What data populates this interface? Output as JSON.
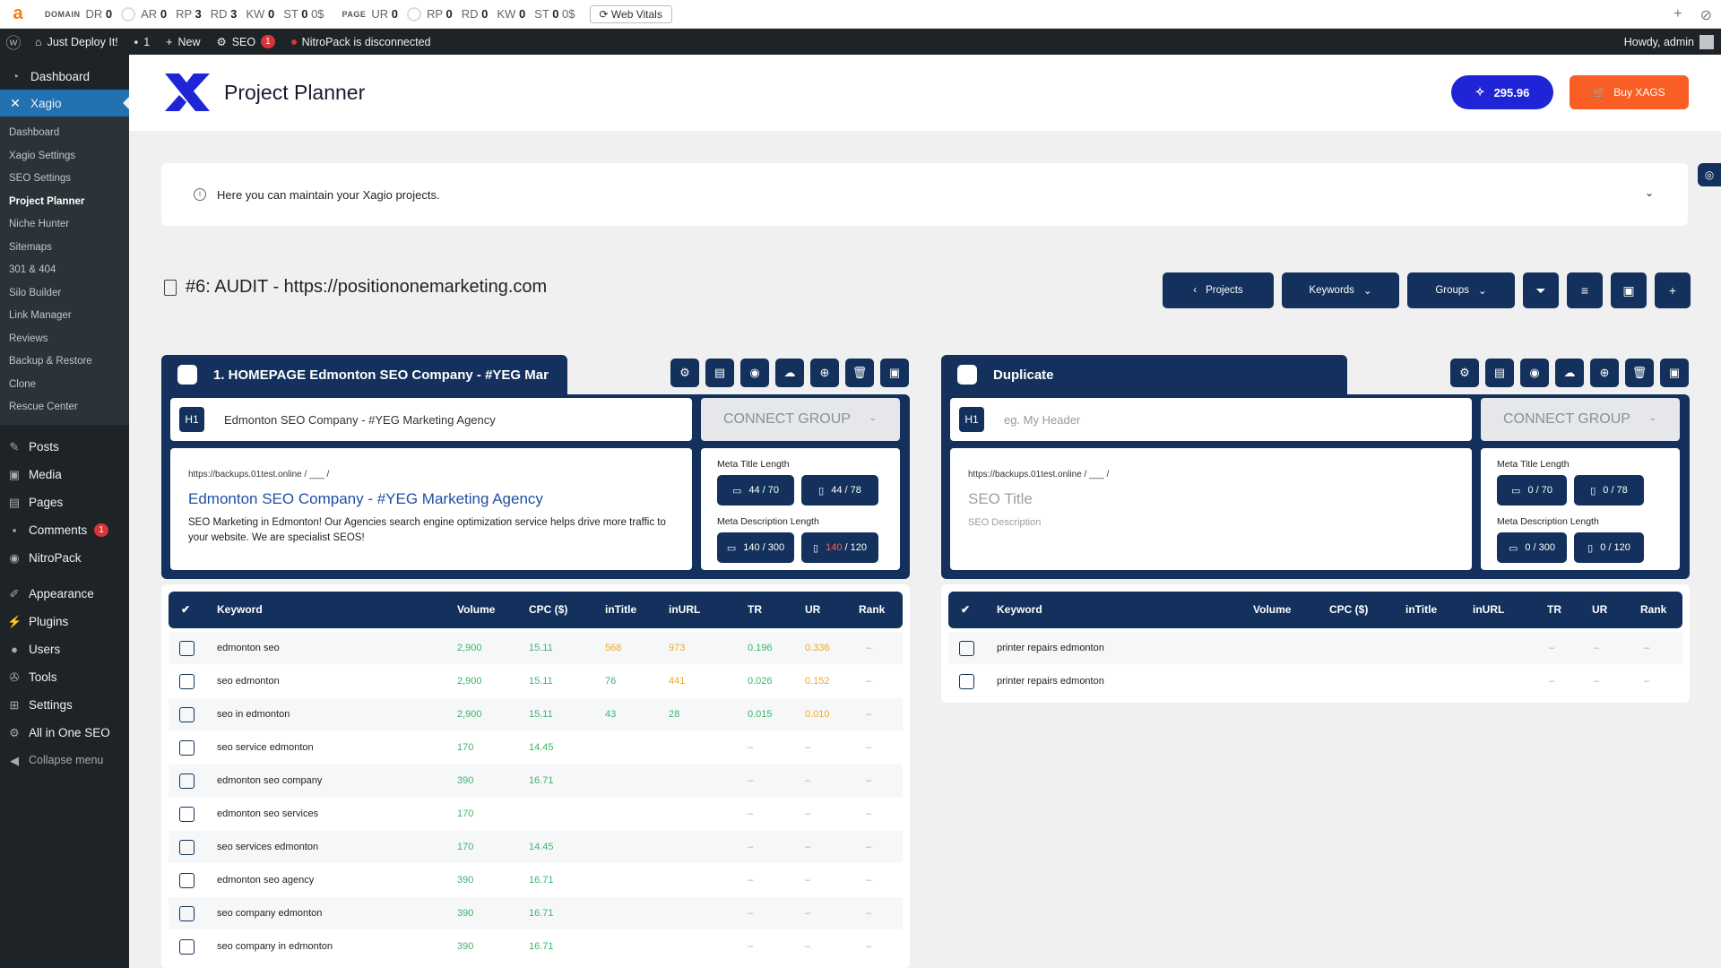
{
  "seobar": {
    "domain_label": "DOMAIN",
    "dr": "DR",
    "dr_v": "0",
    "ar": "AR",
    "ar_v": "0",
    "rp": "RP",
    "rp_v": "3",
    "rd": "RD",
    "rd_v": "3",
    "kw": "KW",
    "kw_v": "0",
    "st": "ST",
    "st_v": "0",
    "st_unit": "0$",
    "page_label": "PAGE",
    "ur": "UR",
    "ur_v": "0",
    "rp2_v": "0",
    "rd2_v": "0",
    "kw2_v": "0",
    "st2_v": "0",
    "st2_unit": "0$",
    "web_vitals": "Web Vitals"
  },
  "adminbar": {
    "site": "Just Deploy It!",
    "comments": "1",
    "new": "New",
    "seo": "SEO",
    "seo_badge": "1",
    "nitro": "NitroPack is disconnected",
    "howdy": "Howdy, admin"
  },
  "sidebar": {
    "dashboard": "Dashboard",
    "xagio": "Xagio",
    "sub": [
      "Dashboard",
      "Xagio Settings",
      "SEO Settings",
      "Project Planner",
      "Niche Hunter",
      "Sitemaps",
      "301 & 404",
      "Silo Builder",
      "Link Manager",
      "Reviews",
      "Backup & Restore",
      "Clone",
      "Rescue Center"
    ],
    "menu": [
      {
        "label": "Posts",
        "icon": "pin-icon"
      },
      {
        "label": "Media",
        "icon": "media-icon"
      },
      {
        "label": "Pages",
        "icon": "pages-icon"
      },
      {
        "label": "Comments",
        "icon": "comment-icon",
        "badge": "1"
      },
      {
        "label": "NitroPack",
        "icon": "nitro-icon"
      }
    ],
    "menu2": [
      {
        "label": "Appearance",
        "icon": "brush-icon"
      },
      {
        "label": "Plugins",
        "icon": "plug-icon"
      },
      {
        "label": "Users",
        "icon": "user-icon"
      },
      {
        "label": "Tools",
        "icon": "wrench-icon"
      },
      {
        "label": "Settings",
        "icon": "settings-icon"
      },
      {
        "label": "All in One SEO",
        "icon": "seo-icon"
      }
    ],
    "collapse": "Collapse menu"
  },
  "header": {
    "title": "Project Planner",
    "xags": "295.96",
    "buy": "Buy XAGS"
  },
  "notice": "Here you can maintain your Xagio projects.",
  "project_title": "#6: AUDIT - https://positiononemarketing.com",
  "tools": {
    "projects": "Projects",
    "keywords": "Keywords",
    "groups": "Groups"
  },
  "columns": {
    "keyword": "Keyword",
    "volume": "Volume",
    "cpc": "CPC ($)",
    "intitle": "inTitle",
    "inurl": "inURL",
    "tr": "TR",
    "ur": "UR",
    "rank": "Rank"
  },
  "group1": {
    "name": "1. HOMEPAGE Edmonton SEO Company - #YEG Mar",
    "h1": "Edmonton SEO Company - #YEG Marketing Agency",
    "connect": "CONNECT GROUP",
    "url": "https://backups.01test.online / ___ /",
    "seo_title": "Edmonton SEO Company - #YEG Marketing Agency",
    "seo_desc": "SEO Marketing in Edmonton! Our Agencies search engine optimization service helps drive more traffic to your website. We are specialist SEOS!",
    "meta_title_label": "Meta Title Length",
    "mt_desktop": "44 / 70",
    "mt_mobile": "44 / 78",
    "meta_desc_label": "Meta Description Length",
    "md_desktop": "140 / 300",
    "md_mobile_a": "140",
    "md_mobile_b": " / 120",
    "rows": [
      {
        "kw": "edmonton seo",
        "vol": "2,900",
        "cpc": "15.11",
        "intitle": "568",
        "inurl": "973",
        "tr": "0.196",
        "ur": "0.336",
        "rank": "–"
      },
      {
        "kw": "seo edmonton",
        "vol": "2,900",
        "cpc": "15.11",
        "intitle": "76",
        "inurl": "441",
        "tr": "0.026",
        "ur": "0.152",
        "rank": "–"
      },
      {
        "kw": "seo in edmonton",
        "vol": "2,900",
        "cpc": "15.11",
        "intitle": "43",
        "inurl": "28",
        "tr": "0.015",
        "ur": "0.010",
        "rank": "–"
      },
      {
        "kw": "seo service edmonton",
        "vol": "170",
        "cpc": "14.45",
        "intitle": "",
        "inurl": "",
        "tr": "–",
        "ur": "–",
        "rank": "–"
      },
      {
        "kw": "edmonton seo company",
        "vol": "390",
        "cpc": "16.71",
        "intitle": "",
        "inurl": "",
        "tr": "–",
        "ur": "–",
        "rank": "–"
      },
      {
        "kw": "edmonton seo services",
        "vol": "170",
        "cpc": "",
        "intitle": "",
        "inurl": "",
        "tr": "–",
        "ur": "–",
        "rank": "–"
      },
      {
        "kw": "seo services edmonton",
        "vol": "170",
        "cpc": "14.45",
        "intitle": "",
        "inurl": "",
        "tr": "–",
        "ur": "–",
        "rank": "–"
      },
      {
        "kw": "edmonton seo agency",
        "vol": "390",
        "cpc": "16.71",
        "intitle": "",
        "inurl": "",
        "tr": "–",
        "ur": "–",
        "rank": "–"
      },
      {
        "kw": "seo company edmonton",
        "vol": "390",
        "cpc": "16.71",
        "intitle": "",
        "inurl": "",
        "tr": "–",
        "ur": "–",
        "rank": "–"
      },
      {
        "kw": "seo company in edmonton",
        "vol": "390",
        "cpc": "16.71",
        "intitle": "",
        "inurl": "",
        "tr": "–",
        "ur": "–",
        "rank": "–"
      }
    ]
  },
  "group2": {
    "name": "Duplicate",
    "h1_placeholder": "eg. My Header",
    "connect": "CONNECT GROUP",
    "url": "https://backups.01test.online / ___ /",
    "seo_title": "SEO Title",
    "seo_desc": "SEO Description",
    "meta_title_label": "Meta Title Length",
    "mt_desktop": "0 / 70",
    "mt_mobile": "0 / 78",
    "meta_desc_label": "Meta Description Length",
    "md_desktop": "0 / 300",
    "md_mobile": "0 / 120",
    "rows": [
      {
        "kw": "printer repairs edmonton",
        "vol": "",
        "cpc": "",
        "intitle": "",
        "inurl": "",
        "tr": "–",
        "ur": "–",
        "rank": "–"
      },
      {
        "kw": "printer repairs edmonton",
        "vol": "",
        "cpc": "",
        "intitle": "",
        "inurl": "",
        "tr": "–",
        "ur": "–",
        "rank": "–"
      }
    ]
  },
  "colors": {
    "navy": "#13315c",
    "accent_blue": "#1f25d6",
    "buy_orange": "#f95e24",
    "wp_blue": "#2271b1",
    "green": "#3db46d",
    "orange": "#f5a623"
  }
}
